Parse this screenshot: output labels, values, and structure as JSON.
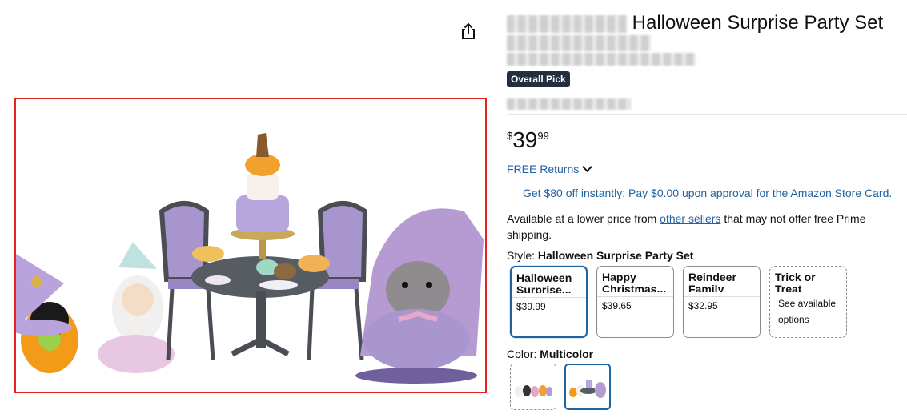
{
  "product": {
    "title_visible": "Halloween Surprise Party Set",
    "badge": "Overall Pick",
    "price": {
      "symbol": "$",
      "whole": "39",
      "fraction": "99"
    },
    "returns": "FREE Returns",
    "promo": "Get $80 off instantly: Pay $0.00 upon approval for the Amazon Store Card.",
    "lower_price": {
      "prefix": "Available at a lower price from ",
      "link": "other sellers",
      "suffix": " that may not offer free Prime shipping."
    }
  },
  "style": {
    "label": "Style:",
    "selected": "Halloween Surprise Party Set",
    "options": [
      {
        "name": "Halloween Surprise...",
        "price": "$39.99",
        "selected": true
      },
      {
        "name": "Happy Christmas...",
        "price": "$39.65",
        "selected": false
      },
      {
        "name": "Reindeer Family",
        "price": "$32.95",
        "selected": false
      },
      {
        "name": "Trick or Treat Parade",
        "price": "See available options",
        "selected": false
      }
    ]
  },
  "color": {
    "label": "Color:",
    "selected": "Multicolor"
  },
  "icons": {
    "share": "share-icon",
    "chevron": "chevron-down-icon"
  },
  "colors": {
    "link": "#2162a1",
    "badge_bg": "#232f3e",
    "image_highlight": "#e3231f",
    "selected_border": "#2162a1"
  }
}
